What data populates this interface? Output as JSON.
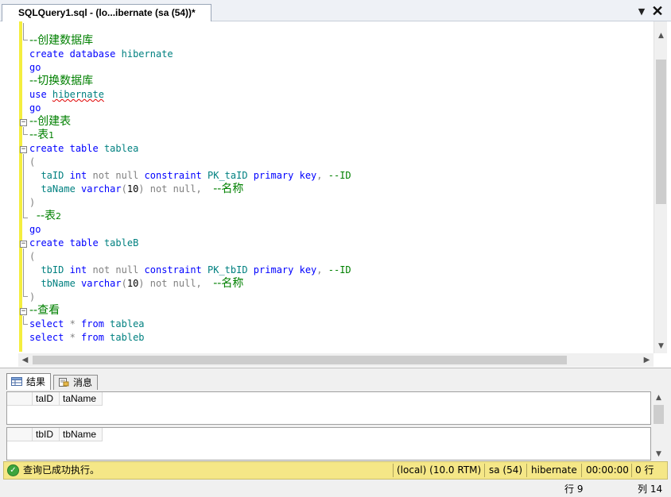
{
  "tab": {
    "title": "SQLQuery1.sql - (lo...ibernate (sa (54))*"
  },
  "editor": {
    "lines": [
      {
        "parts": [
          {
            "t": "--创建数据库",
            "c": "cm"
          }
        ],
        "cn": true
      },
      {
        "parts": [
          {
            "t": "create",
            "c": "kw"
          },
          {
            "t": " ",
            "c": "nm"
          },
          {
            "t": "database",
            "c": "kw"
          },
          {
            "t": " hibernate",
            "c": "id"
          }
        ]
      },
      {
        "parts": [
          {
            "t": "go",
            "c": "kw"
          }
        ]
      },
      {
        "parts": [
          {
            "t": "--切换数据库",
            "c": "cm"
          }
        ],
        "cn": true
      },
      {
        "parts": [
          {
            "t": "use",
            "c": "kw"
          },
          {
            "t": " ",
            "c": "nm"
          },
          {
            "t": "hibernate",
            "c": "id",
            "squig": true
          }
        ]
      },
      {
        "parts": [
          {
            "t": "go",
            "c": "kw"
          }
        ]
      },
      {
        "parts": [
          {
            "t": "--创建表",
            "c": "cm"
          }
        ],
        "cn": true
      },
      {
        "parts": [
          {
            "t": "--表",
            "c": "cm"
          },
          {
            "t": "1",
            "c": "cm",
            "sm": true
          }
        ],
        "cn": true
      },
      {
        "parts": [
          {
            "t": "create",
            "c": "kw"
          },
          {
            "t": " ",
            "c": "nm"
          },
          {
            "t": "table",
            "c": "kw"
          },
          {
            "t": " tablea",
            "c": "id"
          }
        ]
      },
      {
        "parts": [
          {
            "t": "(",
            "c": "gr"
          }
        ]
      },
      {
        "parts": [
          {
            "t": "  taID ",
            "c": "id"
          },
          {
            "t": "int",
            "c": "kw"
          },
          {
            "t": " not null ",
            "c": "gr"
          },
          {
            "t": "constraint",
            "c": "kw"
          },
          {
            "t": " PK_taID ",
            "c": "id"
          },
          {
            "t": "primary key",
            "c": "kw"
          },
          {
            "t": ",",
            "c": "gr"
          },
          {
            "t": " --ID",
            "c": "cm"
          }
        ]
      },
      {
        "parts": [
          {
            "t": "  taName ",
            "c": "id"
          },
          {
            "t": "varchar",
            "c": "kw"
          },
          {
            "t": "(",
            "c": "gr"
          },
          {
            "t": "10",
            "c": "nm"
          },
          {
            "t": ")",
            "c": "gr"
          },
          {
            "t": " not null,  ",
            "c": "gr"
          },
          {
            "t": "--名称",
            "c": "cm",
            "cnpart": true
          }
        ]
      },
      {
        "parts": [
          {
            "t": ")",
            "c": "gr"
          }
        ]
      },
      {
        "parts": [
          {
            "t": "  --表",
            "c": "cm"
          },
          {
            "t": "2",
            "c": "cm",
            "sm": true
          }
        ],
        "cn": true
      },
      {
        "parts": [
          {
            "t": "go",
            "c": "kw"
          }
        ]
      },
      {
        "parts": [
          {
            "t": "create",
            "c": "kw"
          },
          {
            "t": " ",
            "c": "nm"
          },
          {
            "t": "table",
            "c": "kw"
          },
          {
            "t": " tableB",
            "c": "id"
          }
        ]
      },
      {
        "parts": [
          {
            "t": "(",
            "c": "gr"
          }
        ]
      },
      {
        "parts": [
          {
            "t": "  tbID ",
            "c": "id"
          },
          {
            "t": "int",
            "c": "kw"
          },
          {
            "t": " not null ",
            "c": "gr"
          },
          {
            "t": "constraint",
            "c": "kw"
          },
          {
            "t": " PK_tbID ",
            "c": "id"
          },
          {
            "t": "primary key",
            "c": "kw"
          },
          {
            "t": ",",
            "c": "gr"
          },
          {
            "t": " --ID",
            "c": "cm"
          }
        ]
      },
      {
        "parts": [
          {
            "t": "  tbName ",
            "c": "id"
          },
          {
            "t": "varchar",
            "c": "kw"
          },
          {
            "t": "(",
            "c": "gr"
          },
          {
            "t": "10",
            "c": "nm"
          },
          {
            "t": ")",
            "c": "gr"
          },
          {
            "t": " not null,  ",
            "c": "gr"
          },
          {
            "t": "--名称",
            "c": "cm",
            "cnpart": true
          }
        ]
      },
      {
        "parts": [
          {
            "t": ")",
            "c": "gr"
          }
        ]
      },
      {
        "parts": [
          {
            "t": "--查看",
            "c": "cm"
          }
        ],
        "cn": true
      },
      {
        "parts": [
          {
            "t": "select",
            "c": "kw"
          },
          {
            "t": " * ",
            "c": "gr"
          },
          {
            "t": "from",
            "c": "kw"
          },
          {
            "t": " tablea",
            "c": "id"
          }
        ]
      },
      {
        "parts": [
          {
            "t": "select",
            "c": "kw"
          },
          {
            "t": " * ",
            "c": "gr"
          },
          {
            "t": "from",
            "c": "kw"
          },
          {
            "t": " tableb",
            "c": "id"
          }
        ]
      }
    ]
  },
  "results": {
    "tab_results": "结果",
    "tab_messages": "消息",
    "grid1": {
      "columns": [
        "taID",
        "taName"
      ]
    },
    "grid2": {
      "columns": [
        "tbID",
        "tbName"
      ]
    }
  },
  "status": {
    "message": "查询已成功执行。",
    "server": "(local) (10.0 RTM)",
    "user": "sa (54)",
    "database": "hibernate",
    "elapsed": "00:00:00",
    "rows": "0 行"
  },
  "position": {
    "line": "行 9",
    "column": "列 14"
  },
  "colors": {
    "keyword": "#0000ff",
    "identifier": "#008080",
    "comment": "#008000",
    "operator": "#808080",
    "status_bar": "#f5e787",
    "modified_gutter": "#f4ee3e"
  }
}
